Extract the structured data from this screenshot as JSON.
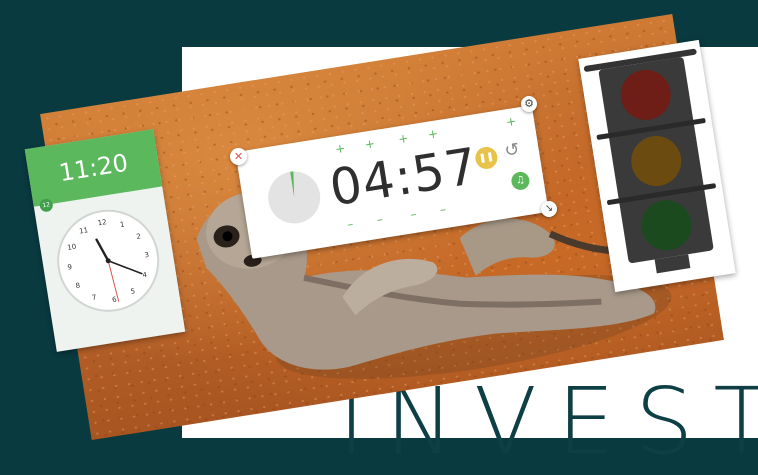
{
  "background": {
    "dark_color": "#093a40",
    "panel_color": "#ffffff"
  },
  "headline": {
    "text": "INVEST"
  },
  "clock_widget": {
    "digital_time": "11:20",
    "badge": "12",
    "accent_color": "#5cb85c",
    "analog": {
      "numbers": [
        "12",
        "1",
        "2",
        "3",
        "4",
        "5",
        "6",
        "7",
        "8",
        "9",
        "10",
        "11"
      ],
      "hour": 11,
      "minute": 20
    }
  },
  "timer_widget": {
    "time": "04:57",
    "progress_remaining_fraction": 0.02,
    "icons": {
      "pause": "pause-icon",
      "reset": "reset-icon",
      "music": "music-icon"
    }
  },
  "controls": {
    "close": "close-icon",
    "settings": "gear-icon",
    "resize": "resize-icon"
  },
  "traffic_light": {
    "lights": [
      "red",
      "amber",
      "green"
    ],
    "colors": [
      "#6e1e16",
      "#6b4b10",
      "#1c4a1f"
    ]
  }
}
